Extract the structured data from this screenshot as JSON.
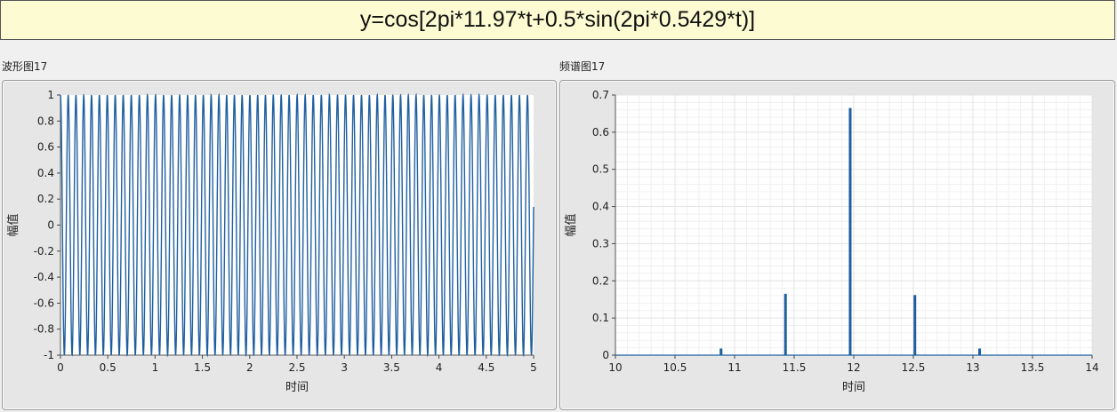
{
  "header": {
    "formula": "y=cos[2pi*11.97*t+0.5*sin(2pi*0.5429*t)]"
  },
  "waveform": {
    "label": "波形图17"
  },
  "spectrum": {
    "label": "频谱图17"
  },
  "colors": {
    "plot_line": "#1f5fa0",
    "title_bg": "#fdfbd2",
    "grid": "#e3e3e3"
  },
  "chart_data": [
    {
      "type": "line",
      "title": "波形图17",
      "xlabel": "时间",
      "ylabel": "幅值",
      "xlim": [
        0,
        5
      ],
      "ylim": [
        -1,
        1
      ],
      "xticks": [
        "0",
        "0.5",
        "1",
        "1.5",
        "2",
        "2.5",
        "3",
        "3.5",
        "4",
        "4.5",
        "5"
      ],
      "yticks": [
        "-1",
        "-0.8",
        "-0.6",
        "-0.4",
        "-0.2",
        "0",
        "0.2",
        "0.4",
        "0.6",
        "0.8",
        "1"
      ],
      "grid": false,
      "series": [
        {
          "function": "cos(2*pi*11.97*t + 0.5*sin(2*pi*0.5429*t))",
          "t_range": [
            0,
            5
          ]
        }
      ]
    },
    {
      "type": "bar",
      "title": "频谱图17",
      "xlabel": "时间",
      "ylabel": "幅值",
      "xlim": [
        10,
        14
      ],
      "ylim": [
        0,
        0.7
      ],
      "xticks": [
        "10",
        "10.5",
        "11",
        "11.5",
        "12",
        "12.5",
        "13",
        "13.5",
        "14"
      ],
      "yticks": [
        "0",
        "0.1",
        "0.2",
        "0.3",
        "0.4",
        "0.5",
        "0.6",
        "0.7"
      ],
      "grid": true,
      "x": [
        10.886,
        11.427,
        11.97,
        12.513,
        13.056
      ],
      "values": [
        0.018,
        0.165,
        0.665,
        0.162,
        0.018
      ]
    }
  ]
}
